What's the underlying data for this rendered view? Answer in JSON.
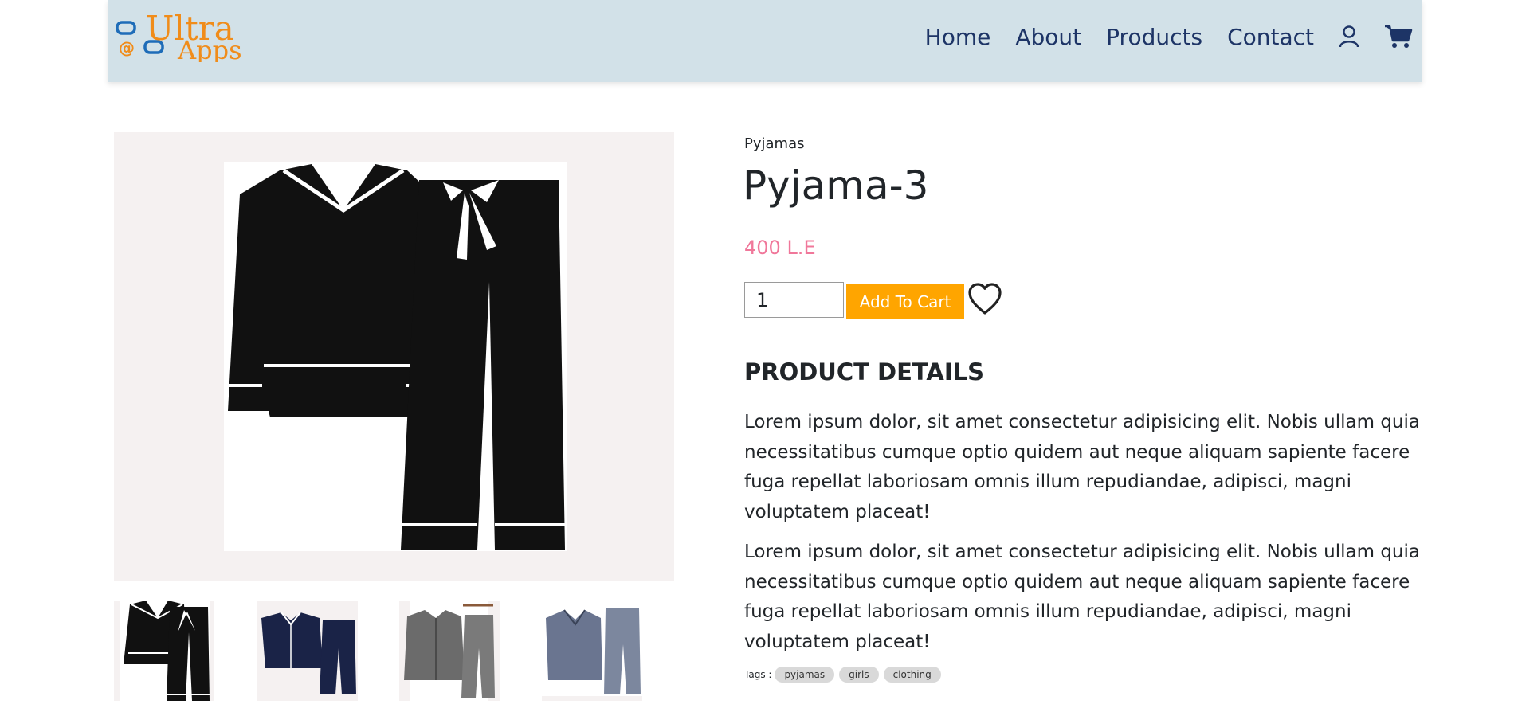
{
  "brand": {
    "logo_line1": "Ultra",
    "logo_line2": "Apps",
    "accent": "#f08c1a",
    "icon_color": "#1e6cb8"
  },
  "nav": {
    "links": [
      "Home",
      "About",
      "Products",
      "Contact"
    ],
    "user_icon": "user-icon",
    "cart_icon": "cart-icon",
    "text_color": "#1d3466",
    "background": "#d2e1e8"
  },
  "gallery": {
    "main_alt": "Pyjama-3",
    "thumbnails": [
      "black pyjama set",
      "navy pyjama set",
      "grey pyjama set",
      "blue-grey satin pyjama set"
    ]
  },
  "product": {
    "category": "Pyjamas",
    "title": "Pyjama-3",
    "price": "400 L.E",
    "price_color": "#f0779a",
    "quantity": "1",
    "add_to_cart": "Add To Cart",
    "add_to_cart_color": "#ffa500",
    "wishlist_icon": "heart-icon",
    "details_heading": "PRODUCT DETAILS",
    "description_1": "Lorem ipsum dolor, sit amet consectetur adipisicing elit. Nobis ullam quia necessitatibus cumque optio quidem aut neque aliquam sapiente facere fuga repellat laboriosam omnis illum repudiandae, adipisci, magni voluptatem placeat!",
    "description_2": " Lorem ipsum dolor, sit amet consectetur adipisicing elit. Nobis ullam quia necessitatibus cumque optio quidem aut neque aliquam sapiente facere fuga repellat laboriosam omnis illum repudiandae, adipisci, magni voluptatem placeat!",
    "tags_label": "Tags :",
    "tags": [
      "pyjamas",
      "girls",
      "clothing"
    ]
  }
}
